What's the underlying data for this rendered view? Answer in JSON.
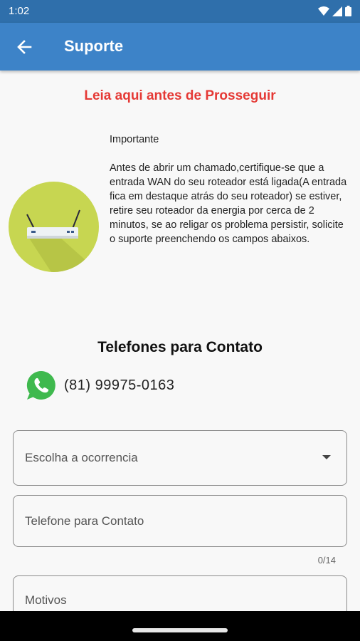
{
  "status_bar": {
    "time": "1:02"
  },
  "app_bar": {
    "title": "Suporte"
  },
  "warning_text": "Leia aqui antes de Prosseguir",
  "info": {
    "title": "Importante",
    "body": "Antes de abrir um chamado,certifique-se que a entrada WAN do seu roteador está ligada(A entrada fica em destaque atrás do seu roteador) se estiver, retire seu roteador da energia por cerca de 2 minutos, se ao religar os problema persistir, solicite o suporte preenchendo os campos abaixos."
  },
  "contact": {
    "heading": "Telefones para Contato",
    "phone": "(81) 99975-0163"
  },
  "form": {
    "occurrence_label": "Escolha a ocorrencia",
    "phone_label": "Telefone para Contato",
    "phone_counter": "0/14",
    "reasons_label": "Motivos"
  },
  "colors": {
    "app_bar": "#3d83c8",
    "status_bar": "#2f6fab",
    "warning": "#e53935",
    "router_circle": "#c7d651",
    "whatsapp": "#3fb94e"
  }
}
